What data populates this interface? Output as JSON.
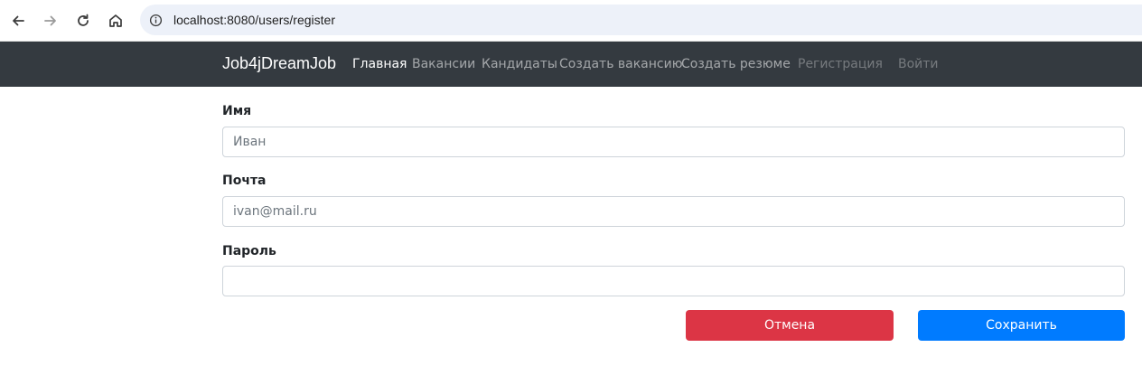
{
  "browser": {
    "url": "localhost:8080/users/register",
    "icons": [
      "back-arrow-icon",
      "forward-arrow-icon",
      "reload-icon",
      "home-icon",
      "site-info-icon"
    ]
  },
  "navbar": {
    "brand": "Job4jDreamJob",
    "links": [
      {
        "label": "Главная",
        "state": "active"
      },
      {
        "label": "Вакансии",
        "state": "normal"
      },
      {
        "label": "Кандидаты",
        "state": "normal"
      },
      {
        "label": "Создать вакансию",
        "state": "normal"
      },
      {
        "label": "Создать резюме",
        "state": "normal"
      },
      {
        "label": "Регистрация",
        "state": "muted"
      },
      {
        "label": "Войти",
        "state": "muted"
      }
    ],
    "background": "#343a40"
  },
  "form": {
    "name": {
      "label": "Имя",
      "placeholder": "Иван",
      "value": ""
    },
    "email": {
      "label": "Почта",
      "placeholder": "ivan@mail.ru",
      "value": ""
    },
    "password": {
      "label": "Пароль",
      "placeholder": "",
      "value": ""
    },
    "cancel_label": "Отмена",
    "save_label": "Сохранить"
  },
  "colors": {
    "cancel": "#dc3545",
    "save": "#007bff"
  }
}
